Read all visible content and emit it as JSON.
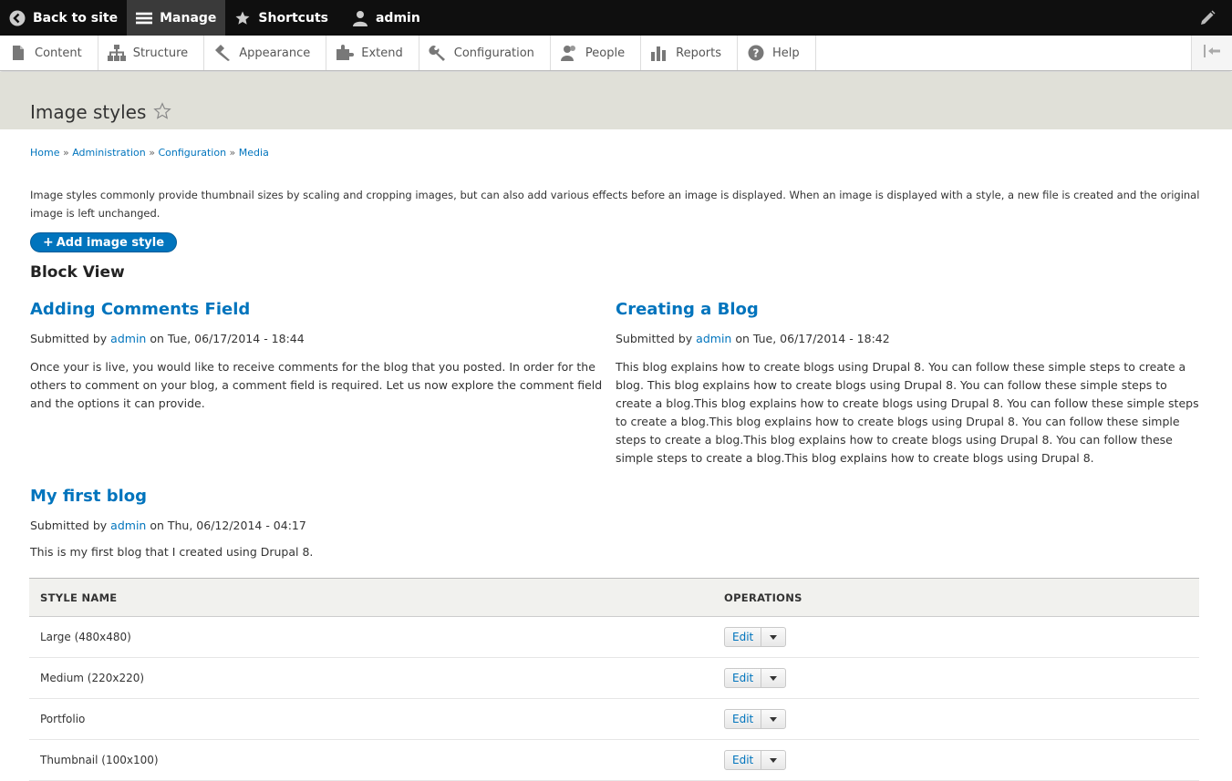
{
  "toolbar": {
    "back_label": "Back to site",
    "manage_label": "Manage",
    "shortcuts_label": "Shortcuts",
    "user_label": "admin"
  },
  "tray": {
    "items": [
      {
        "label": "Content",
        "icon": "file-icon"
      },
      {
        "label": "Structure",
        "icon": "sitemap-icon"
      },
      {
        "label": "Appearance",
        "icon": "paintbrush-icon"
      },
      {
        "label": "Extend",
        "icon": "puzzle-icon"
      },
      {
        "label": "Configuration",
        "icon": "wrench-icon"
      },
      {
        "label": "People",
        "icon": "people-icon"
      },
      {
        "label": "Reports",
        "icon": "bar-chart-icon"
      },
      {
        "label": "Help",
        "icon": "help-icon"
      }
    ]
  },
  "page": {
    "title": "Image styles",
    "breadcrumb": [
      "Home",
      "Administration",
      "Configuration",
      "Media"
    ],
    "breadcrumb_sep": " » ",
    "description": "Image styles commonly provide thumbnail sizes by scaling and cropping images, but can also add various effects before an image is displayed. When an image is displayed with a style, a new file is created and the original image is left unchanged.",
    "add_button": "Add image style",
    "block_title": "Block View"
  },
  "nodes": [
    {
      "title": "Adding Comments Field",
      "submitted_prefix": "Submitted by",
      "author": "admin",
      "date": "on Tue, 06/17/2014 - 18:44",
      "body": "Once your is live, you would like to receive comments for the blog that you posted. In order for the others to comment on your blog, a comment field is required. Let us now explore the comment field and the options it can provide."
    },
    {
      "title": "Creating a Blog",
      "submitted_prefix": "Submitted by",
      "author": "admin",
      "date": "on Tue, 06/17/2014 - 18:42",
      "body": "This blog explains how to create blogs using Drupal 8. You can follow these simple steps to create a blog. This blog explains how to create blogs using Drupal 8. You can follow these simple steps to create a blog.This blog explains how to create blogs using Drupal 8. You can follow these simple steps to create a blog.This blog explains how to create blogs using Drupal 8. You can follow these simple steps to create a blog.This blog explains how to create blogs using Drupal 8. You can follow these simple steps to create a blog.This blog explains how to create blogs using Drupal 8."
    },
    {
      "title": "My first blog",
      "submitted_prefix": "Submitted by",
      "author": "admin",
      "date": "on Thu, 06/12/2014 - 04:17",
      "body": "This is my first blog that I created using Drupal 8."
    }
  ],
  "table": {
    "headers": [
      "STYLE NAME",
      "OPERATIONS"
    ],
    "edit_label": "Edit",
    "rows": [
      {
        "name": "Large (480x480)"
      },
      {
        "name": "Medium (220x220)"
      },
      {
        "name": "Portfolio"
      },
      {
        "name": "Thumbnail (100x100)"
      }
    ]
  },
  "colors": {
    "link": "#0074bd",
    "toolbar_bg": "#0f0f0f",
    "header_bg": "#e0e0d8"
  }
}
